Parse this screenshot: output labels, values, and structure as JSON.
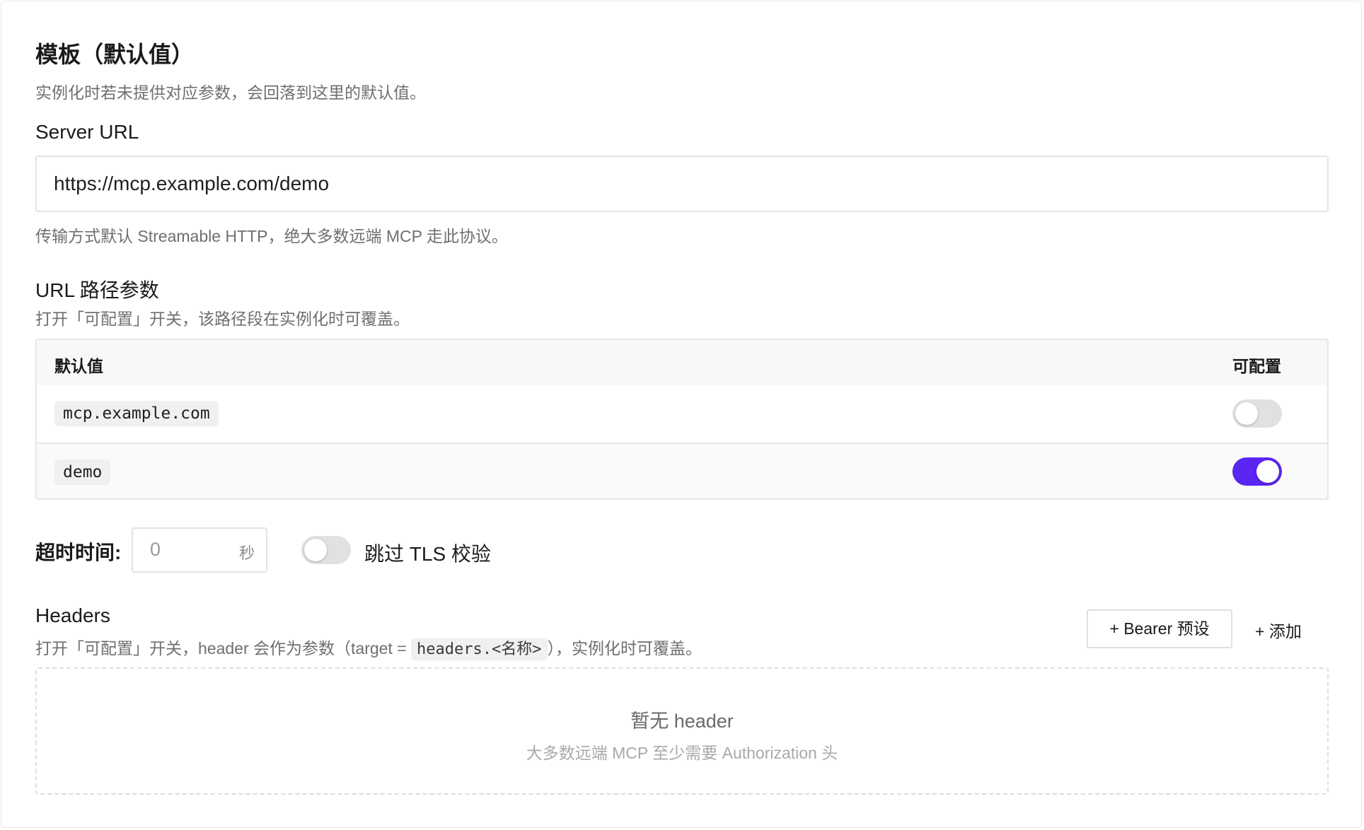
{
  "template": {
    "title": "模板（默认值）",
    "description": "实例化时若未提供对应参数，会回落到这里的默认值。"
  },
  "server_url": {
    "label": "Server URL",
    "value": "https://mcp.example.com/demo",
    "help": "传输方式默认 Streamable HTTP，绝大多数远端 MCP 走此协议。"
  },
  "path_params": {
    "label": "URL 路径参数",
    "description": "打开「可配置」开关，该路径段在实例化时可覆盖。",
    "columns": {
      "default": "默认值",
      "configurable": "可配置"
    },
    "rows": [
      {
        "value": "mcp.example.com",
        "configurable": false
      },
      {
        "value": "demo",
        "configurable": true
      }
    ]
  },
  "timeout": {
    "label": "超时时间:",
    "value": "0",
    "unit": "秒"
  },
  "tls": {
    "label": "跳过 TLS 校验",
    "enabled": false
  },
  "headers": {
    "label": "Headers",
    "desc_prefix": "打开「可配置」开关，header 会作为参数（target = ",
    "desc_code": "headers.<名称>",
    "desc_suffix": "），实例化时可覆盖。",
    "bearer_button": "+ Bearer 预设",
    "add_button": "+ 添加",
    "empty_title": "暂无 header",
    "empty_subtitle": "大多数远端 MCP 至少需要 Authorization 头"
  },
  "colors": {
    "accent": "#5b25f2",
    "toggle_off": "#e1e1e1",
    "muted_text": "#6f6f6f"
  }
}
